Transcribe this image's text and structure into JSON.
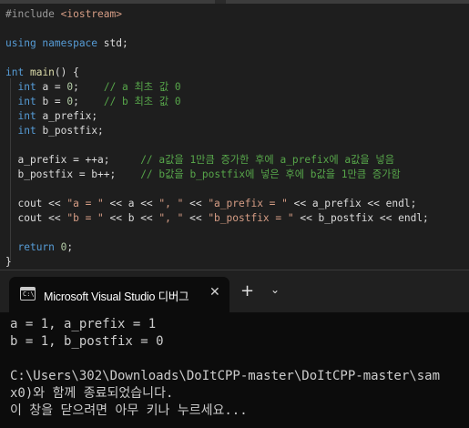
{
  "editor": {
    "lines": [
      [
        {
          "c": "pp",
          "t": "#include "
        },
        {
          "c": "inc",
          "t": "<iostream>"
        }
      ],
      [],
      [
        {
          "c": "kw",
          "t": "using namespace"
        },
        {
          "c": "id",
          "t": " std;"
        }
      ],
      [],
      [
        {
          "c": "kw",
          "t": "int"
        },
        {
          "c": "id",
          "t": " "
        },
        {
          "c": "fn",
          "t": "main"
        },
        {
          "c": "id",
          "t": "() {"
        }
      ],
      [
        {
          "c": "id",
          "t": "  "
        },
        {
          "c": "kw",
          "t": "int"
        },
        {
          "c": "id",
          "t": " a = "
        },
        {
          "c": "num",
          "t": "0"
        },
        {
          "c": "id",
          "t": ";    "
        },
        {
          "c": "cm",
          "t": "// a 최초 값 0"
        }
      ],
      [
        {
          "c": "id",
          "t": "  "
        },
        {
          "c": "kw",
          "t": "int"
        },
        {
          "c": "id",
          "t": " b = "
        },
        {
          "c": "num",
          "t": "0"
        },
        {
          "c": "id",
          "t": ";    "
        },
        {
          "c": "cm",
          "t": "// b 최초 값 0"
        }
      ],
      [
        {
          "c": "id",
          "t": "  "
        },
        {
          "c": "kw",
          "t": "int"
        },
        {
          "c": "id",
          "t": " a_prefix;"
        }
      ],
      [
        {
          "c": "id",
          "t": "  "
        },
        {
          "c": "kw",
          "t": "int"
        },
        {
          "c": "id",
          "t": " b_postfix;"
        }
      ],
      [],
      [
        {
          "c": "id",
          "t": "  a_prefix = ++a;     "
        },
        {
          "c": "cm",
          "t": "// a값을 1만큼 증가한 후에 a_prefix에 a값을 넣음"
        }
      ],
      [
        {
          "c": "id",
          "t": "  b_postfix = b++;    "
        },
        {
          "c": "cm",
          "t": "// b값을 b_postfix에 넣은 후에 b값을 1만큼 증가함"
        }
      ],
      [],
      [
        {
          "c": "id",
          "t": "  cout << "
        },
        {
          "c": "str",
          "t": "\"a = \""
        },
        {
          "c": "id",
          "t": " << a << "
        },
        {
          "c": "str",
          "t": "\", \""
        },
        {
          "c": "id",
          "t": " << "
        },
        {
          "c": "str",
          "t": "\"a_prefix = \""
        },
        {
          "c": "id",
          "t": " << a_prefix << endl;"
        }
      ],
      [
        {
          "c": "id",
          "t": "  cout << "
        },
        {
          "c": "str",
          "t": "\"b = \""
        },
        {
          "c": "id",
          "t": " << b << "
        },
        {
          "c": "str",
          "t": "\", \""
        },
        {
          "c": "id",
          "t": " << "
        },
        {
          "c": "str",
          "t": "\"b_postfix = \""
        },
        {
          "c": "id",
          "t": " << b_postfix << endl;"
        }
      ],
      [],
      [
        {
          "c": "id",
          "t": "  "
        },
        {
          "c": "kw",
          "t": "return"
        },
        {
          "c": "id",
          "t": " "
        },
        {
          "c": "num",
          "t": "0"
        },
        {
          "c": "id",
          "t": ";"
        }
      ],
      [
        {
          "c": "id",
          "t": "}"
        }
      ]
    ]
  },
  "terminal": {
    "tab_icon": "console-window-icon",
    "tab_icon_text": "C:\\",
    "tab_title": "Microsoft Visual Studio 디버그",
    "close_icon": "close-icon",
    "close_glyph": "✕",
    "new_tab_icon": "plus-icon",
    "new_tab_glyph": "+",
    "dropdown_icon": "chevron-down-icon",
    "dropdown_glyph": "⌄",
    "output": [
      "a = 1, a_prefix = 1",
      "b = 1, b_postfix = 0",
      "",
      "C:\\Users\\302\\Downloads\\DoItCPP-master\\DoItCPP-master\\sam",
      "x0)와 함께 종료되었습니다.",
      "이 창을 닫으려면 아무 키나 누르세요..."
    ]
  }
}
